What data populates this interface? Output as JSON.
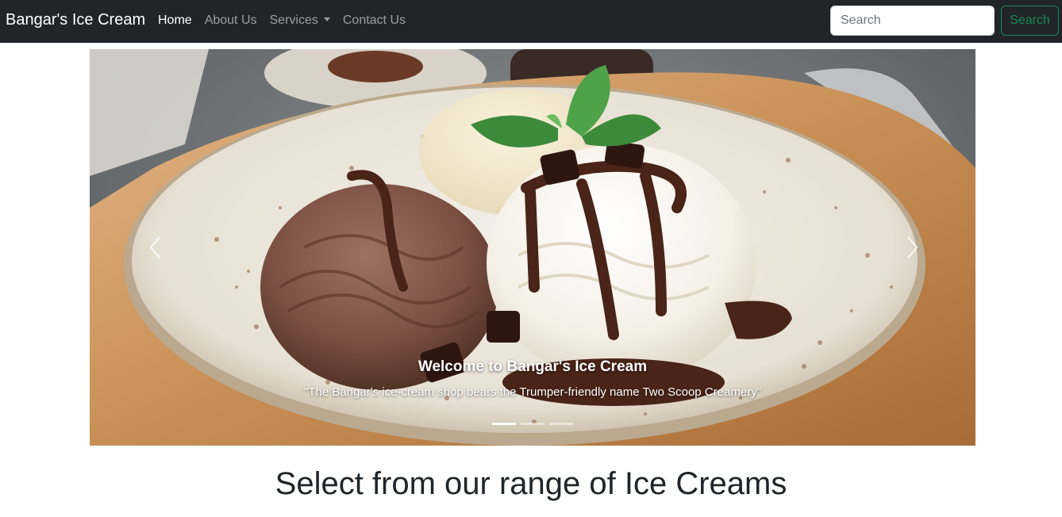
{
  "navbar": {
    "brand": "Bangar's Ice Cream",
    "links": [
      {
        "label": "Home",
        "active": true
      },
      {
        "label": "About Us"
      },
      {
        "label": "Services",
        "dropdown": true
      },
      {
        "label": "Contact Us"
      }
    ],
    "search": {
      "placeholder": "Search",
      "button_label": "Search"
    }
  },
  "carousel": {
    "caption_title": "Welcome to Bangar's Ice Cream",
    "caption_text": "\"The Bangar's ice-cream shop bears the Trumper-friendly name Two Scoop Creamery\"",
    "slide_count": 3,
    "active_slide": 1,
    "prev_icon": "chevron-left-icon",
    "next_icon": "chevron-right-icon"
  },
  "main": {
    "heading": "Select from our range of Ice Creams"
  },
  "colors": {
    "navbar_bg": "#212529",
    "search_accent": "#198754",
    "heading_text": "#212529"
  }
}
